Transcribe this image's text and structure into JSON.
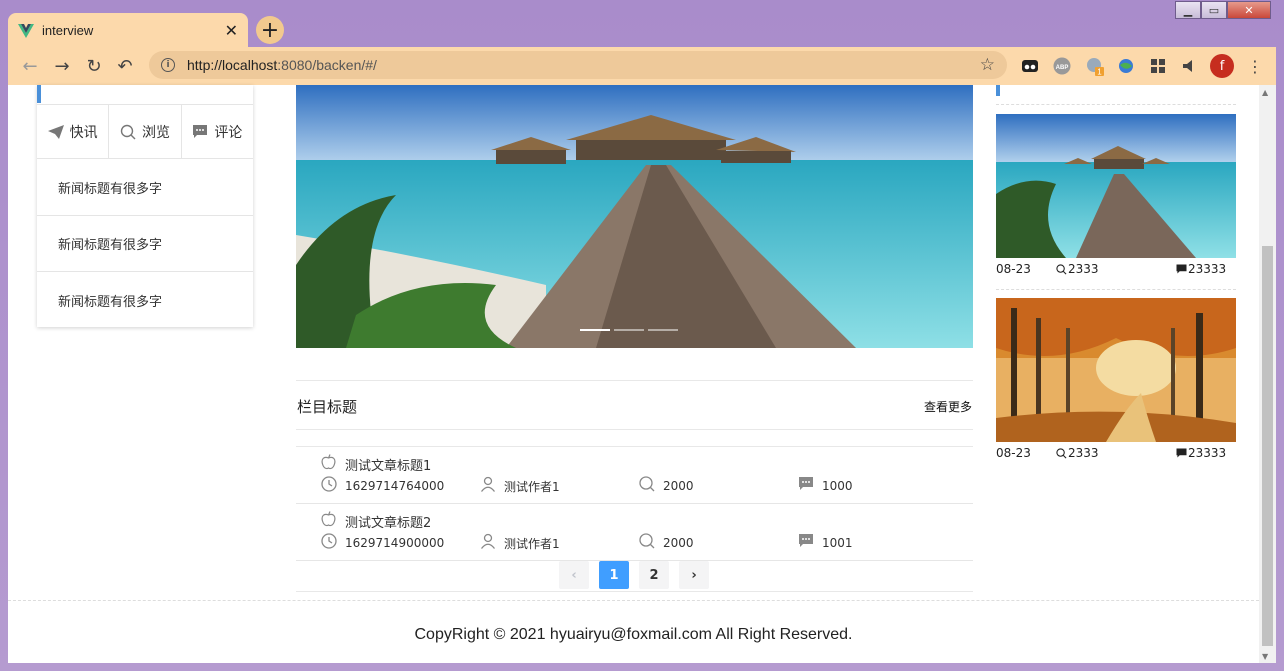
{
  "browser": {
    "tab_title": "interview",
    "tab_close": "✕",
    "new_tab": "+",
    "url_host": "http://localhost",
    "url_rest": ":8080/backen/#/",
    "extension_badge": "1",
    "profile_initial": "f"
  },
  "left_card": {
    "tabs": [
      {
        "label": "快讯",
        "icon": "paper-plane-icon"
      },
      {
        "label": "浏览",
        "icon": "search-icon"
      },
      {
        "label": "评论",
        "icon": "comment-icon"
      }
    ],
    "news": [
      "新闻标题有很多字",
      "新闻标题有很多字",
      "新闻标题有很多字"
    ]
  },
  "carousel": {
    "slides": 3,
    "active_index": 0
  },
  "section": {
    "title": "栏目标题",
    "more": "查看更多"
  },
  "articles": [
    {
      "title": "测试文章标题1",
      "time": "1629714764000",
      "author": "测试作者1",
      "views": "2000",
      "comments": "1000"
    },
    {
      "title": "测试文章标题2",
      "time": "1629714900000",
      "author": "测试作者1",
      "views": "2000",
      "comments": "1001"
    }
  ],
  "pagination": {
    "prev": "‹",
    "pages": [
      "1",
      "2"
    ],
    "active": "1",
    "next": "›"
  },
  "side_posts": [
    {
      "date": "08-23",
      "views": "2333",
      "comments": "23333"
    },
    {
      "date": "08-23",
      "views": "2333",
      "comments": "23333"
    }
  ],
  "footer": {
    "text": "CopyRight © 2021 hyuairyu@foxmail.com All Right Reserved."
  }
}
